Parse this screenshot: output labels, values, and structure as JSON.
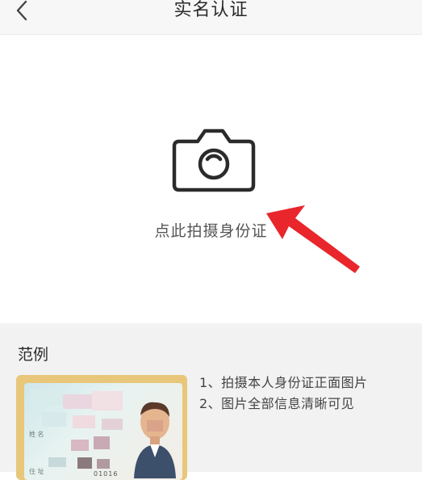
{
  "header": {
    "title": "实名认证"
  },
  "upload": {
    "label": "点此拍摄身份证"
  },
  "example": {
    "title": "范例",
    "notes": [
      "1、拍摄本人身份证正面图片",
      "2、图片全部信息清晰可见"
    ],
    "card": {
      "name_prefix": "姓 名",
      "address_prefix": "住 址",
      "number_fragment": "01016"
    }
  },
  "colors": {
    "arrow": "#e8262c",
    "card_frame": "#e8c77a",
    "text_muted": "#555555"
  }
}
